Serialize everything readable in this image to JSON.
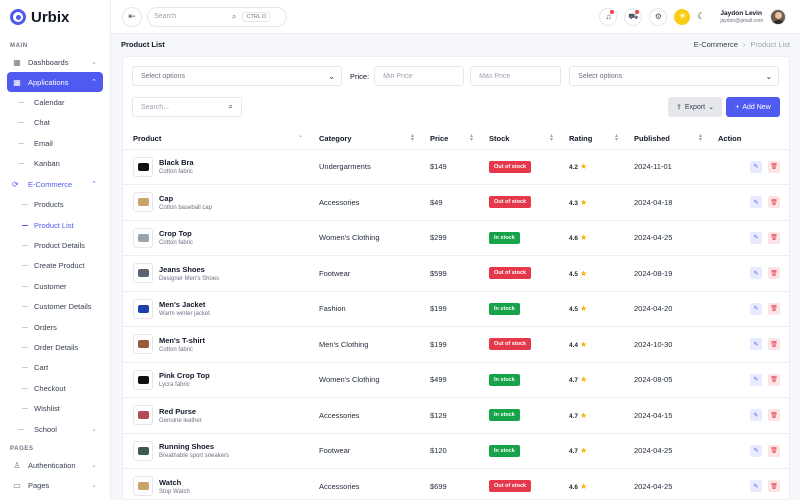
{
  "brand": {
    "name": "Urbix",
    "color": "#4f5bf0"
  },
  "sidebar": {
    "section_main": "MAIN",
    "section_pages": "PAGES",
    "dashboards": "Dashboards",
    "applications": "Applications",
    "apps": [
      "Calendar",
      "Chat",
      "Email",
      "Kanban"
    ],
    "ecommerce": "E-Commerce",
    "ecommerce_items": [
      "Products",
      "Product List",
      "Product Details",
      "Create Product",
      "Customer",
      "Customer Details",
      "Orders",
      "Order Details",
      "Cart",
      "Checkout",
      "Wishlist"
    ],
    "school": "School",
    "authentication": "Authentication",
    "pages": "Pages"
  },
  "header": {
    "search_placeholder": "Search",
    "shortcut": "CTRL D",
    "user_name": "Jaydon Levin",
    "user_email": "jaydon@gmail.com"
  },
  "breadcrumb": {
    "title": "Product List",
    "parent": "E-Commerce",
    "current": "Product List"
  },
  "filters": {
    "select_placeholder": "Select options",
    "price_label": "Price:",
    "min_placeholder": "Min Price",
    "max_placeholder": "Max Price",
    "search_placeholder": "Search..."
  },
  "toolbar": {
    "export_label": "Export",
    "add_label": "Add New"
  },
  "table": {
    "headers": [
      "Product",
      "Category",
      "Price",
      "Stock",
      "Rating",
      "Published",
      "Action"
    ],
    "rows": [
      {
        "name": "Black Bra",
        "sub": "Cotton fabric",
        "category": "Undergarments",
        "price": "$149",
        "stock": "Out of stock",
        "rating": "4.2",
        "published": "2024-11-01"
      },
      {
        "name": "Cap",
        "sub": "Cotton baseball cap",
        "category": "Accessories",
        "price": "$49",
        "stock": "Out of stock",
        "rating": "4.3",
        "published": "2024-04-18"
      },
      {
        "name": "Crop Top",
        "sub": "Cotton fabric",
        "category": "Women's Clothing",
        "price": "$299",
        "stock": "In stock",
        "rating": "4.6",
        "published": "2024-04-25"
      },
      {
        "name": "Jeans Shoes",
        "sub": "Designer Men's Shoes",
        "category": "Footwear",
        "price": "$599",
        "stock": "Out of stock",
        "rating": "4.5",
        "published": "2024-08-19"
      },
      {
        "name": "Men's Jacket",
        "sub": "Warm winter jacket",
        "category": "Fashion",
        "price": "$199",
        "stock": "In stock",
        "rating": "4.5",
        "published": "2024-04-20"
      },
      {
        "name": "Men's T-shirt",
        "sub": "Cotton fabric",
        "category": "Men's Clothing",
        "price": "$199",
        "stock": "Out of stock",
        "rating": "4.4",
        "published": "2024-10-30"
      },
      {
        "name": "Pink Crop Top",
        "sub": "Lycra fabric",
        "category": "Women's Clothing",
        "price": "$499",
        "stock": "In stock",
        "rating": "4.7",
        "published": "2024-08-05"
      },
      {
        "name": "Red Purse",
        "sub": "Genuine leather",
        "category": "Accessories",
        "price": "$129",
        "stock": "In stock",
        "rating": "4.7",
        "published": "2024-04-15"
      },
      {
        "name": "Running Shoes",
        "sub": "Breathable sport sneakers",
        "category": "Footwear",
        "price": "$120",
        "stock": "In stock",
        "rating": "4.7",
        "published": "2024-04-25"
      },
      {
        "name": "Watch",
        "sub": "Stop Watch",
        "category": "Accessories",
        "price": "$699",
        "stock": "Out of stock",
        "rating": "4.6",
        "published": "2024-04-25"
      }
    ]
  },
  "thumb_colors": [
    "#111111",
    "#c9a46b",
    "#9aa3ad",
    "#5a6470",
    "#1e40af",
    "#9a5b3f",
    "#111111",
    "#b24a5a",
    "#3f5a4c",
    "#c9a46b"
  ],
  "colors": {
    "accent": "#4f5bf0",
    "out_of_stock": "#e5394b",
    "in_stock": "#16a34a",
    "star": "#f5b301"
  }
}
